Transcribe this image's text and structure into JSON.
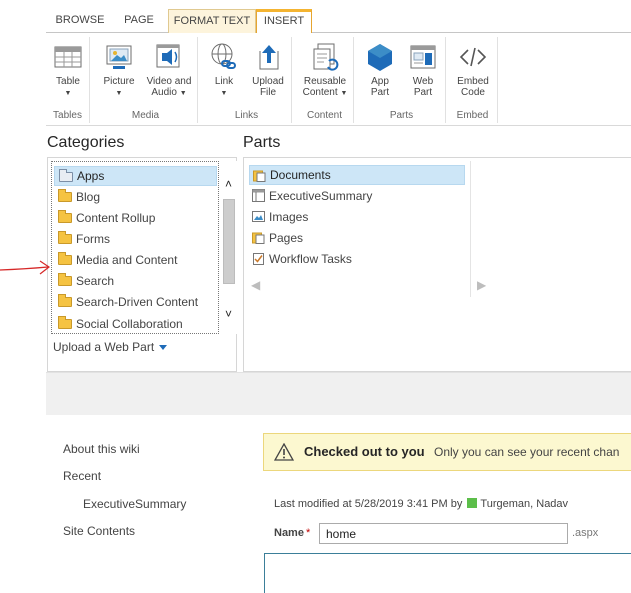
{
  "tabs": [
    {
      "label": "BROWSE"
    },
    {
      "label": "PAGE"
    },
    {
      "label": "FORMAT TEXT"
    },
    {
      "label": "INSERT"
    }
  ],
  "ribbon": {
    "groups": {
      "tables": {
        "label": "Tables",
        "buttons": {
          "table": "Table"
        }
      },
      "media": {
        "label": "Media",
        "buttons": {
          "picture": "Picture",
          "video1": "Video and",
          "video2": "Audio"
        }
      },
      "links": {
        "label": "Links",
        "buttons": {
          "link": "Link",
          "upload1": "Upload",
          "upload2": "File"
        }
      },
      "content": {
        "label": "Content",
        "buttons": {
          "reusable1": "Reusable",
          "reusable2": "Content"
        }
      },
      "parts": {
        "label": "Parts",
        "buttons": {
          "app1": "App",
          "app2": "Part",
          "web1": "Web",
          "web2": "Part"
        }
      },
      "embed": {
        "label": "Embed",
        "buttons": {
          "embed1": "Embed",
          "embed2": "Code"
        }
      }
    }
  },
  "categories": {
    "title": "Categories",
    "items": [
      "Apps",
      "Blog",
      "Content Rollup",
      "Forms",
      "Media and Content",
      "Search",
      "Search-Driven Content",
      "Social Collaboration"
    ],
    "selected": "Apps",
    "upload_label": "Upload a Web Part"
  },
  "parts": {
    "title": "Parts",
    "items": [
      "Documents",
      "ExecutiveSummary",
      "Images",
      "Pages",
      "Workflow Tasks"
    ],
    "selected": "Documents"
  },
  "nav": {
    "about": "About this wiki",
    "recent": "Recent",
    "recent_child": "ExecutiveSummary",
    "site_contents": "Site Contents"
  },
  "status": {
    "strong": "Checked out to you",
    "message": "Only you can see your recent chan"
  },
  "page": {
    "modified_prefix": "Last modified at 5/28/2019 3:41 PM by",
    "modified_user": "Turgeman, Nadav",
    "name_label": "Name",
    "name_required": "*",
    "name_value": "home",
    "extension": ".aspx"
  },
  "colors": {
    "accent_tab": "#f4b431",
    "selection": "#cde6f7",
    "warning_bg": "#fcf8d0",
    "presence": "#5cbe4a",
    "annotation_arrow": "#d62828"
  }
}
